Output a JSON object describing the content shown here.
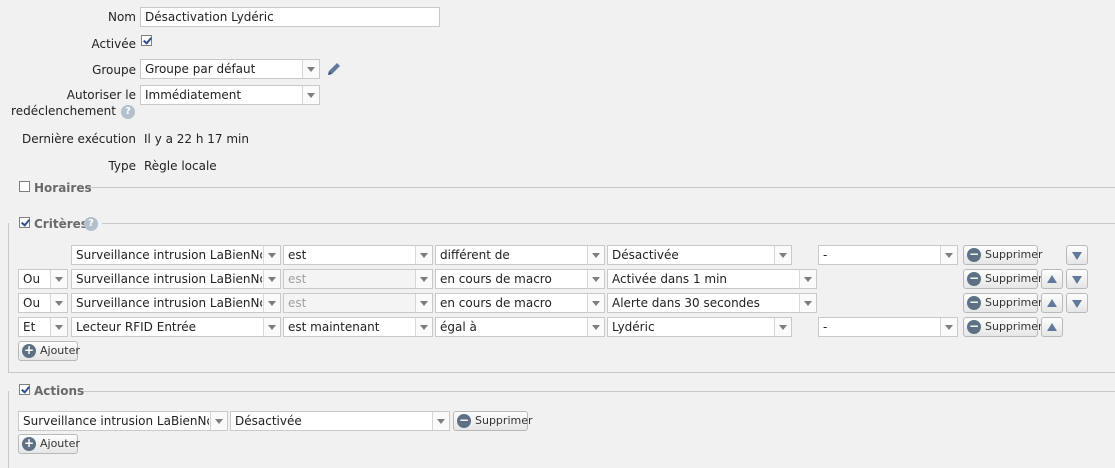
{
  "form": {
    "name_label": "Nom",
    "name_value": "Désactivation Lydéric",
    "active_label": "Activée",
    "active_checked": true,
    "group_label": "Groupe",
    "group_value": "Groupe par défaut",
    "retrigger_label_line1": "Autoriser le",
    "retrigger_label_line2": "redéclenchement",
    "retrigger_value": "Immédiatement",
    "last_run_label": "Dernière exécution",
    "last_run_value": "Il y a 22 h 17 min",
    "type_label": "Type",
    "type_value": "Règle locale"
  },
  "sections": {
    "schedules": {
      "title": "Horaires",
      "checked": false
    },
    "criteria": {
      "title": "Critères",
      "checked": true
    },
    "actions": {
      "title": "Actions",
      "checked": true
    }
  },
  "help_glyph": "?",
  "buttons": {
    "delete": "Supprimer",
    "add": "Ajouter",
    "add_glyph": "+",
    "delete_glyph": "−"
  },
  "criteria": [
    {
      "connector": "",
      "device": "Surveillance intrusion LaBienNommée",
      "operator": "est",
      "operator_disabled": false,
      "comparison": "différent de",
      "value": "Désactivée",
      "extra": "-",
      "move_up": false,
      "move_down": true
    },
    {
      "connector": "Ou",
      "device": "Surveillance intrusion LaBienNommée",
      "operator": "est",
      "operator_disabled": true,
      "comparison": "en cours de macro",
      "value": "Activée dans 1 min",
      "extra": null,
      "move_up": true,
      "move_down": true
    },
    {
      "connector": "Ou",
      "device": "Surveillance intrusion LaBienNommée",
      "operator": "est",
      "operator_disabled": true,
      "comparison": "en cours de macro",
      "value": "Alerte dans 30 secondes",
      "extra": null,
      "move_up": true,
      "move_down": true
    },
    {
      "connector": "Et",
      "device": "Lecteur RFID Entrée",
      "operator": "est maintenant",
      "operator_disabled": false,
      "comparison": "égal à",
      "value": "Lydéric",
      "extra": "-",
      "move_up": true,
      "move_down": false
    }
  ],
  "actions": [
    {
      "device": "Surveillance intrusion LaBienNommée",
      "value": "Désactivée"
    }
  ],
  "colors": {
    "background": "#f1f1f1",
    "icon_blue": "#5f7a9a",
    "check_blue": "#2d4f8e"
  }
}
